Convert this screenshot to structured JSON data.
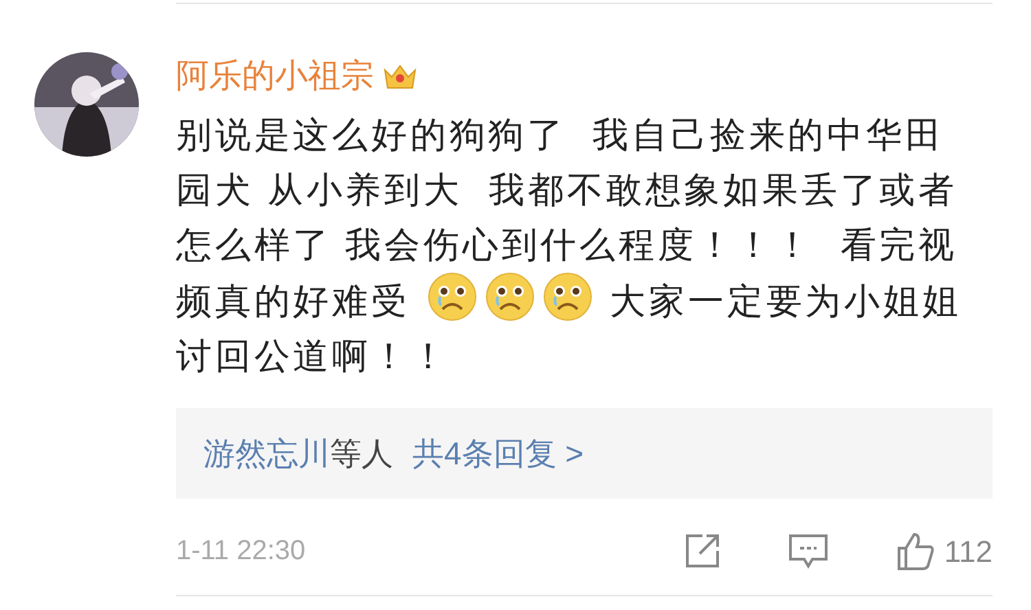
{
  "comment": {
    "author": "阿乐的小祖宗",
    "body": [
      {
        "kind": "text",
        "text": "别说是这么好的狗狗了  我自己捡来的中华田园犬 从小养到大  我都不敢想象如果丢了或者怎么样了 我会伤心到什么程度！！！  看完视频真的好难受 "
      },
      {
        "kind": "emoji"
      },
      {
        "kind": "emoji"
      },
      {
        "kind": "emoji"
      },
      {
        "kind": "text",
        "text": " 大家一定要为小姐姐讨回公道啊！！"
      }
    ],
    "replies": {
      "user": "游然忘川",
      "suffix": "等人",
      "link": "共4条回复 >"
    },
    "time": "1-11 22:30",
    "likes": "112"
  }
}
